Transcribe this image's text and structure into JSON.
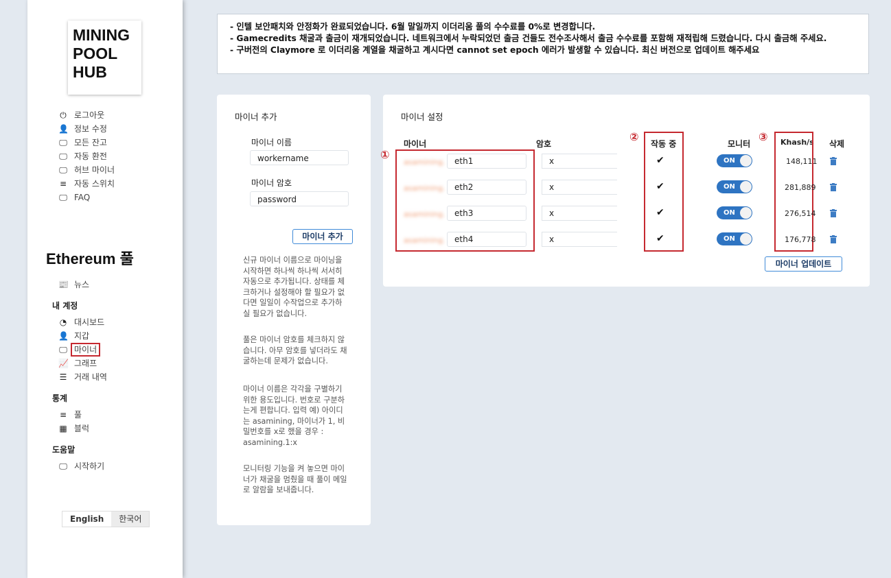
{
  "logo": {
    "line1": "MINING",
    "line2": "POOL",
    "line3": "HUB"
  },
  "nav_top": [
    {
      "icon": "⏻",
      "label": "로그아웃",
      "name": "power"
    },
    {
      "icon": "👤",
      "label": "정보 수정",
      "name": "user"
    },
    {
      "icon": "🖵",
      "label": "모든 잔고",
      "name": "monitor"
    },
    {
      "icon": "🖵",
      "label": "자동 환전",
      "name": "monitor"
    },
    {
      "icon": "🖵",
      "label": "허브 마이너",
      "name": "monitor"
    },
    {
      "icon": "≡",
      "label": "자동 스위치",
      "name": "list"
    },
    {
      "icon": "🖵",
      "label": "FAQ",
      "name": "desktop"
    }
  ],
  "pool_title": "Ethereum 풀",
  "news": {
    "icon": "📰",
    "label": "뉴스"
  },
  "my_account": {
    "title": "내 계정",
    "items": [
      {
        "icon": "◔",
        "label": "대시보드",
        "name": "dashboard"
      },
      {
        "icon": "👤",
        "label": "지갑",
        "name": "wallet"
      },
      {
        "icon": "🖵",
        "label": "마이너",
        "name": "miner"
      },
      {
        "icon": "📈",
        "label": "그래프",
        "name": "chart"
      },
      {
        "icon": "☰",
        "label": "거래 내역",
        "name": "list"
      }
    ]
  },
  "stats": {
    "title": "통계",
    "items": [
      {
        "icon": "≡",
        "label": "풀",
        "name": "pool"
      },
      {
        "icon": "▦",
        "label": "블럭",
        "name": "blocks"
      }
    ]
  },
  "help_menu": {
    "title": "도움말",
    "items": [
      {
        "icon": "🖵",
        "label": "시작하기",
        "name": "getting-started"
      }
    ]
  },
  "lang": {
    "en": "English",
    "ko": "한국어"
  },
  "notice": [
    "- 인텔 보안패치와 안정화가 완료되었습니다. 6월 말일까지 이더리움 풀의 수수료를 0%로 변경합니다.",
    "- Gamecredits 채굴과 출금이 재개되었습니다. 네트워크에서 누락되었던 출금 건들도 전수조사해서 출금 수수료를 포함해 재적립해 드렸습니다. 다시 출금해 주세요.",
    "- 구버전의 Claymore 로 이더리움 계열을 채굴하고 계시다면 cannot set epoch 에러가 발생할 수 있습니다. 최신 버전으로 업데이트 해주세요"
  ],
  "add_miner": {
    "title": "마이너 추가",
    "name_label": "마이너 이름",
    "name_value": "workername",
    "pw_label": "마이너 암호",
    "pw_value": "password",
    "button": "마이너 추가",
    "help": [
      "신규 마이너 이름으로 마이닝을 시작하면 하나씩 하나씩 서서히 자동으로 추가됩니다. 상태를 체크하거나 설정해야 할 필요가 없다면 일일이 수작업으로 추가하실 필요가 없습니다.",
      "풀은 마이너 암호를 체크하지 않습니다. 아무 암호를 넣더라도 채굴하는데 문제가 없습니다.",
      "마이너 이름은 각각을 구별하기 위한 용도입니다. 번호로 구분하는게 편합니다. 입력 예) 아이디는 asamining, 마이너가 1, 비밀번호를 x로 했을 경우 : asamining.1:x",
      "모니터링 기능을 켜 놓으면 마이너가 채굴을 멈췄을 때 풀이 메일로 알람을 보내줍니다."
    ]
  },
  "miner_settings": {
    "title": "마이너 설정",
    "headers": {
      "miner": "마이너",
      "password": "암호",
      "active": "작동 중",
      "monitor": "모니터",
      "khash": "Khash/s",
      "delete": "삭제"
    },
    "prefix": "asamining.",
    "rows": [
      {
        "worker": "eth1",
        "password": "x",
        "active": "✔",
        "monitor": "ON",
        "khash": "148,111"
      },
      {
        "worker": "eth2",
        "password": "x",
        "active": "✔",
        "monitor": "ON",
        "khash": "281,889"
      },
      {
        "worker": "eth3",
        "password": "x",
        "active": "✔",
        "monitor": "ON",
        "khash": "276,514"
      },
      {
        "worker": "eth4",
        "password": "x",
        "active": "✔",
        "monitor": "ON",
        "khash": "176,778"
      }
    ],
    "update_button": "마이너 업데이트",
    "markers": [
      "①",
      "②",
      "③"
    ]
  }
}
